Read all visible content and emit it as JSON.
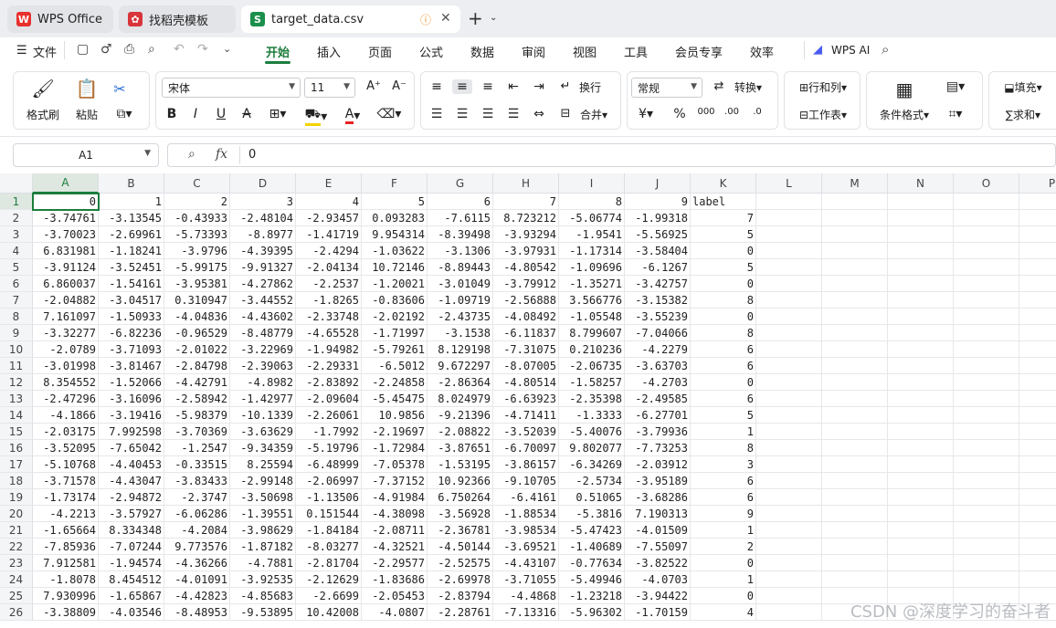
{
  "tabs": [
    {
      "label": "WPS Office",
      "icon": "wps-logo-icon"
    },
    {
      "label": "找稻壳模板",
      "icon": "docer-icon"
    },
    {
      "label": "target_data.csv",
      "icon": "spreadsheet-icon",
      "active": true
    }
  ],
  "menu": {
    "file": "文件",
    "items": [
      "开始",
      "插入",
      "页面",
      "公式",
      "数据",
      "审阅",
      "视图",
      "工具",
      "会员专享",
      "效率"
    ],
    "wps_ai": "WPS AI"
  },
  "ribbon": {
    "format_brush": "格式刷",
    "paste": "粘贴",
    "font_name": "宋体",
    "font_size": "11",
    "wrap": "换行",
    "merge": "合并",
    "number_format": "常规",
    "convert": "转换",
    "rows_cols": "行和列",
    "worksheet": "工作表",
    "conditional_format": "条件格式",
    "fill": "填充",
    "sum": "求和"
  },
  "formula_bar": {
    "cell_ref": "A1",
    "value": "0"
  },
  "columns": [
    "A",
    "B",
    "C",
    "D",
    "E",
    "F",
    "G",
    "H",
    "I",
    "J",
    "K",
    "L",
    "M",
    "N",
    "O",
    "P"
  ],
  "header_row": [
    "0",
    "1",
    "2",
    "3",
    "4",
    "5",
    "6",
    "7",
    "8",
    "9",
    "label"
  ],
  "rows": [
    [
      "-3.74761",
      "-3.13545",
      "-0.43933",
      "-2.48104",
      "-2.93457",
      "0.093283",
      "-7.6115",
      "8.723212",
      "-5.06774",
      "-1.99318",
      "7"
    ],
    [
      "-3.70023",
      "-2.69961",
      "-5.73393",
      "-8.8977",
      "-1.41719",
      "9.954314",
      "-8.39498",
      "-3.93294",
      "-1.9541",
      "-5.56925",
      "5"
    ],
    [
      "6.831981",
      "-1.18241",
      "-3.9796",
      "-4.39395",
      "-2.4294",
      "-1.03622",
      "-3.1306",
      "-3.97931",
      "-1.17314",
      "-3.58404",
      "0"
    ],
    [
      "-3.91124",
      "-3.52451",
      "-5.99175",
      "-9.91327",
      "-2.04134",
      "10.72146",
      "-8.89443",
      "-4.80542",
      "-1.09696",
      "-6.1267",
      "5"
    ],
    [
      "6.860037",
      "-1.54161",
      "-3.95381",
      "-4.27862",
      "-2.2537",
      "-1.20021",
      "-3.01049",
      "-3.79912",
      "-1.35271",
      "-3.42757",
      "0"
    ],
    [
      "-2.04882",
      "-3.04517",
      "0.310947",
      "-3.44552",
      "-1.8265",
      "-0.83606",
      "-1.09719",
      "-2.56888",
      "3.566776",
      "-3.15382",
      "8"
    ],
    [
      "7.161097",
      "-1.50933",
      "-4.04836",
      "-4.43602",
      "-2.33748",
      "-2.02192",
      "-2.43735",
      "-4.08492",
      "-1.05548",
      "-3.55239",
      "0"
    ],
    [
      "-3.32277",
      "-6.82236",
      "-0.96529",
      "-8.48779",
      "-4.65528",
      "-1.71997",
      "-3.1538",
      "-6.11837",
      "8.799607",
      "-7.04066",
      "8"
    ],
    [
      "-2.0789",
      "-3.71093",
      "-2.01022",
      "-3.22969",
      "-1.94982",
      "-5.79261",
      "8.129198",
      "-7.31075",
      "0.210236",
      "-4.2279",
      "6"
    ],
    [
      "-3.01998",
      "-3.81467",
      "-2.84798",
      "-2.39063",
      "-2.29331",
      "-6.5012",
      "9.672297",
      "-8.07005",
      "-2.06735",
      "-3.63703",
      "6"
    ],
    [
      "8.354552",
      "-1.52066",
      "-4.42791",
      "-4.8982",
      "-2.83892",
      "-2.24858",
      "-2.86364",
      "-4.80514",
      "-1.58257",
      "-4.2703",
      "0"
    ],
    [
      "-2.47296",
      "-3.16096",
      "-2.58942",
      "-1.42977",
      "-2.09604",
      "-5.45475",
      "8.024979",
      "-6.63923",
      "-2.35398",
      "-2.49585",
      "6"
    ],
    [
      "-4.1866",
      "-3.19416",
      "-5.98379",
      "-10.1339",
      "-2.26061",
      "10.9856",
      "-9.21396",
      "-4.71411",
      "-1.3333",
      "-6.27701",
      "5"
    ],
    [
      "-2.03175",
      "7.992598",
      "-3.70369",
      "-3.63629",
      "-1.7992",
      "-2.19697",
      "-2.08822",
      "-3.52039",
      "-5.40076",
      "-3.79936",
      "1"
    ],
    [
      "-3.52095",
      "-7.65042",
      "-1.2547",
      "-9.34359",
      "-5.19796",
      "-1.72984",
      "-3.87651",
      "-6.70097",
      "9.802077",
      "-7.73253",
      "8"
    ],
    [
      "-5.10768",
      "-4.40453",
      "-0.33515",
      "8.25594",
      "-6.48999",
      "-7.05378",
      "-1.53195",
      "-3.86157",
      "-6.34269",
      "-2.03912",
      "3"
    ],
    [
      "-3.71578",
      "-4.43047",
      "-3.83433",
      "-2.99148",
      "-2.06997",
      "-7.37152",
      "10.92366",
      "-9.10705",
      "-2.5734",
      "-3.95189",
      "6"
    ],
    [
      "-1.73174",
      "-2.94872",
      "-2.3747",
      "-3.50698",
      "-1.13506",
      "-4.91984",
      "6.750264",
      "-6.4161",
      "0.51065",
      "-3.68286",
      "6"
    ],
    [
      "-4.2213",
      "-3.57927",
      "-6.06286",
      "-1.39551",
      "0.151544",
      "-4.38098",
      "-3.56928",
      "-1.88534",
      "-5.3816",
      "7.190313",
      "9"
    ],
    [
      "-1.65664",
      "8.334348",
      "-4.2084",
      "-3.98629",
      "-1.84184",
      "-2.08711",
      "-2.36781",
      "-3.98534",
      "-5.47423",
      "-4.01509",
      "1"
    ],
    [
      "-7.85936",
      "-7.07244",
      "9.773576",
      "-1.87182",
      "-8.03277",
      "-4.32521",
      "-4.50144",
      "-3.69521",
      "-1.40689",
      "-7.55097",
      "2"
    ],
    [
      "7.912581",
      "-1.94574",
      "-4.36266",
      "-4.7881",
      "-2.81704",
      "-2.29577",
      "-2.52575",
      "-4.43107",
      "-0.77634",
      "-3.82522",
      "0"
    ],
    [
      "-1.8078",
      "8.454512",
      "-4.01091",
      "-3.92535",
      "-2.12629",
      "-1.83686",
      "-2.69978",
      "-3.71055",
      "-5.49946",
      "-4.0703",
      "1"
    ],
    [
      "7.930996",
      "-1.65867",
      "-4.42823",
      "-4.85683",
      "-2.6699",
      "-2.05453",
      "-2.83794",
      "-4.4868",
      "-1.23218",
      "-3.94422",
      "0"
    ],
    [
      "-3.38809",
      "-4.03546",
      "-8.48953",
      "-9.53895",
      "10.42008",
      "-4.0807",
      "-2.28761",
      "-7.13316",
      "-5.96302",
      "-1.70159",
      "4"
    ]
  ],
  "watermark": "CSDN @深度学习的奋斗者"
}
